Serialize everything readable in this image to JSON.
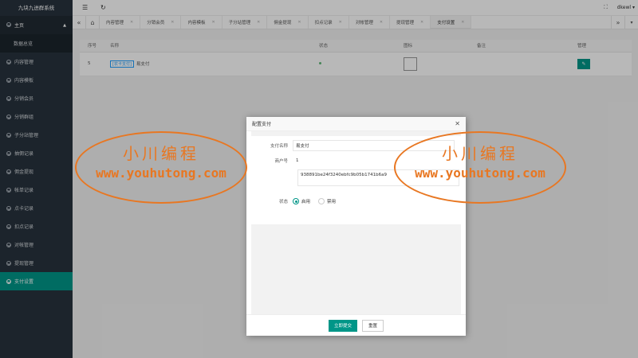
{
  "app": {
    "brand": "九块九进群系统"
  },
  "sidebar": {
    "home": "主页",
    "home_sub": "数据总览",
    "items": [
      {
        "label": "内容管理"
      },
      {
        "label": "内容模板"
      },
      {
        "label": "分销会员"
      },
      {
        "label": "分销群组"
      },
      {
        "label": "子分站管理"
      },
      {
        "label": "抽佣记录"
      },
      {
        "label": "佣金提现"
      },
      {
        "label": "帐单记录"
      },
      {
        "label": "点卡记录"
      },
      {
        "label": "扣点记录"
      },
      {
        "label": "对帐管理"
      },
      {
        "label": "提现管理"
      },
      {
        "label": "支付设置"
      }
    ]
  },
  "header": {
    "user": "dkewl"
  },
  "tabs": [
    {
      "label": "内容管理"
    },
    {
      "label": "分销会员"
    },
    {
      "label": "内容模板"
    },
    {
      "label": "子分站管理"
    },
    {
      "label": "佣金提现"
    },
    {
      "label": "扣点记录"
    },
    {
      "label": "对帐管理"
    },
    {
      "label": "提现管理"
    },
    {
      "label": "支付设置"
    }
  ],
  "table": {
    "headers": [
      "序号",
      "名称",
      "状态",
      "图标",
      "备注",
      "管理"
    ],
    "rows": [
      {
        "index": "5",
        "tag": "[农卡支付]",
        "name": "易支付"
      }
    ]
  },
  "modal": {
    "title": "配置支付",
    "fields": {
      "name_label": "支付名称",
      "name_value": "易支付",
      "merchant_label": "商户号",
      "merchant_value": "1",
      "key_value": "938891be24f3240ebfc9b05b1741b6a9",
      "status_label": "状态",
      "status_on": "启用",
      "status_off": "禁用"
    },
    "submit": "立即提交",
    "reset": "重置"
  },
  "watermark": {
    "cn": "小川编程",
    "en": "www.youhutong.com"
  },
  "colors": {
    "accent": "#009688",
    "sidebar": "#28333e",
    "watermark": "#e87722"
  }
}
